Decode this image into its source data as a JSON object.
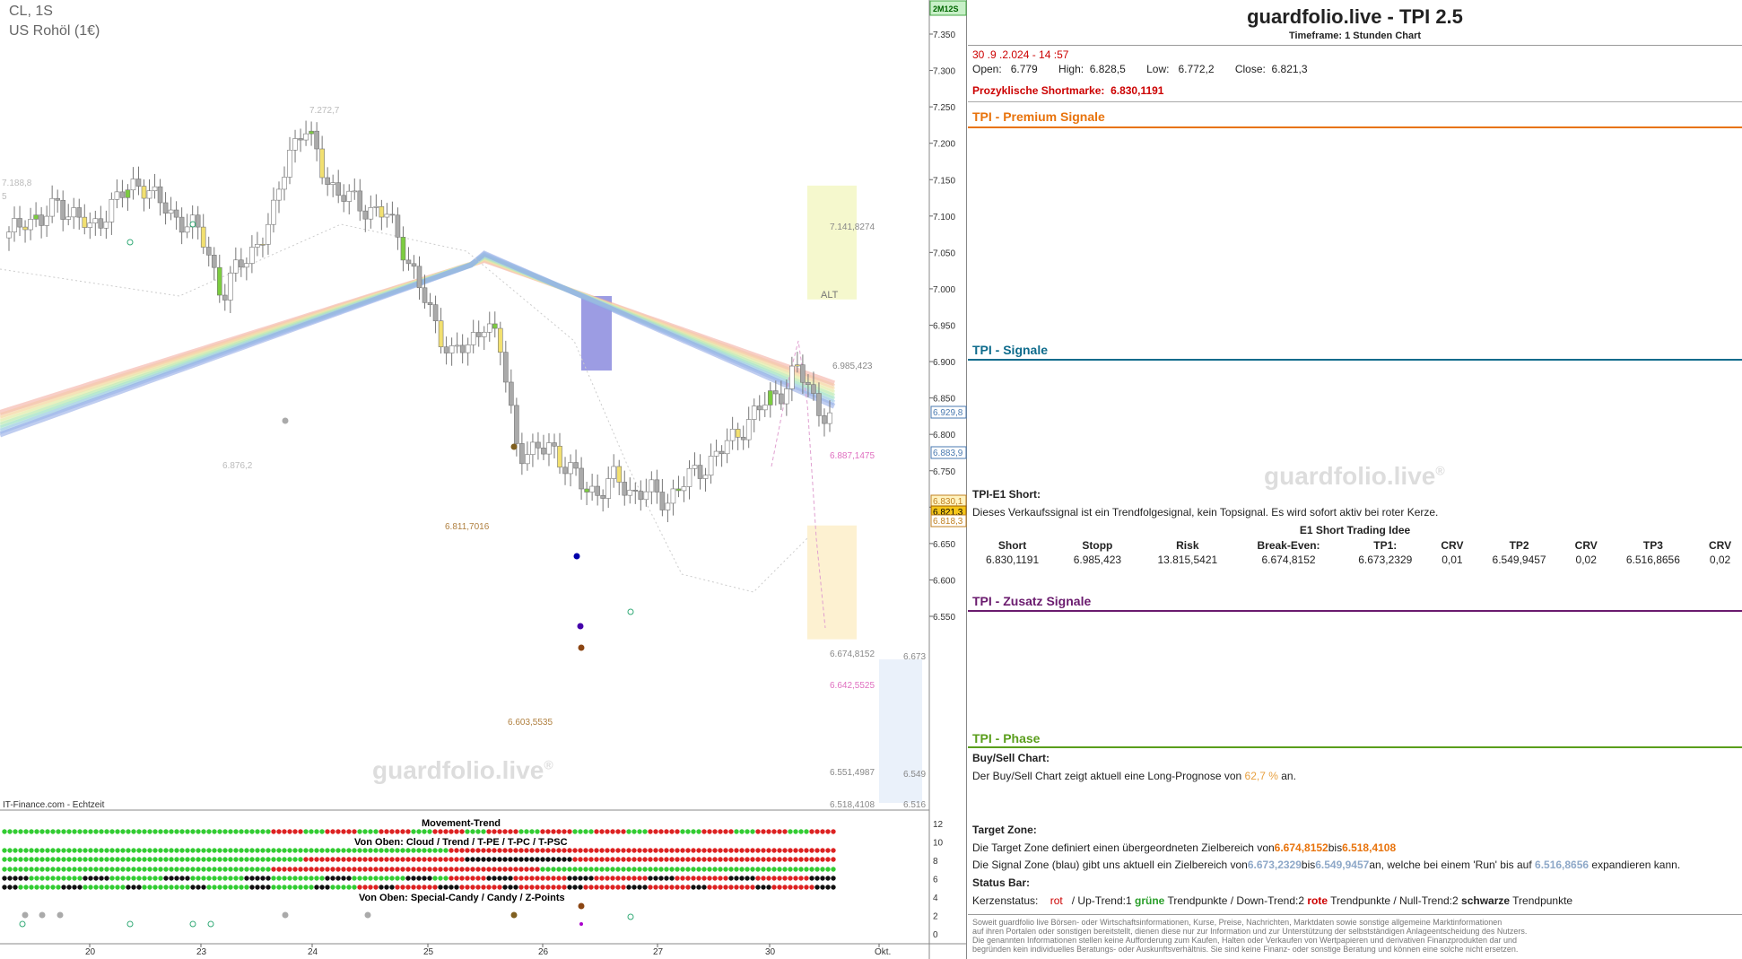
{
  "chart_header": {
    "symbol": "CL, 1S",
    "name": "US Rohöl (1€)",
    "badge": "2M12S"
  },
  "chart_footer": {
    "source": "IT-Finance.com - Echtzeit"
  },
  "watermark": "guardfolio.live",
  "watermark_symbol": "®",
  "indicator_labels": {
    "movement": "Movement-Trend",
    "cloud": "Von Oben: Cloud / Trend / T-PE / T-PC / T-PSC",
    "candy": "Von Oben: Special-Candy / Candy / Z-Points"
  },
  "indicator_axis": [
    "12",
    "10",
    "8",
    "6",
    "4",
    "2",
    "0"
  ],
  "chart_annotations": {
    "alt": "ALT",
    "high_label": "7.272,7",
    "left_label": "7.188,8",
    "left_label2": "5",
    "low_label": "6.876,2",
    "label_6811": "6.811,7016",
    "label_6603": "6.603,5535",
    "zone_top": "7.141,8274",
    "zone_mid": "6.985,423",
    "pink_label": "6.887,1475",
    "tz_top": "6.674,8152",
    "tz_pink": "6.642,5525",
    "tz_low1": "6.551,4987",
    "tz_low2": "6.518,4108",
    "blue_label_1": "6.673",
    "blue_label_2": "6.549",
    "blue_label_3": "6.516"
  },
  "price_boxes": [
    "6.929,8",
    "6.883,9",
    "6.830,1",
    "6.821,3",
    "6.818,3"
  ],
  "chart_data": {
    "type": "candlestick",
    "title": "CL, 1S",
    "x_tick_labels": [
      "20",
      "23",
      "24",
      "25",
      "26",
      "27",
      "30",
      "Okt."
    ],
    "y_tick_labels": [
      "7.350",
      "7.300",
      "7.250",
      "7.200",
      "7.150",
      "7.100",
      "7.050",
      "7.000",
      "6.950",
      "6.900",
      "6.850",
      "6.800",
      "6.750",
      "6.700",
      "6.650",
      "6.600",
      "6.550"
    ],
    "ylim": [
      6.52,
      7.37
    ],
    "grid": false,
    "levels": {
      "short_mark": 6.8301191,
      "stop": 6.985423,
      "target_zone_top": 6.6748152,
      "target_zone_bottom": 6.5184108,
      "signal_zone_top": 6.6732329,
      "signal_zone_bottom": 6.5499457,
      "alt_zone_top": 7.1418274,
      "alt_zone_bottom": 6.985423
    },
    "series": [
      {
        "name": "CL",
        "approx_close_path": [
          7.07,
          7.1,
          7.09,
          7.12,
          7.1,
          7.08,
          7.11,
          7.13,
          7.15,
          7.12,
          7.1,
          7.09,
          7.06,
          6.99,
          7.03,
          7.06,
          7.09,
          7.19,
          7.22,
          7.17,
          7.13,
          7.12,
          7.11,
          7.1,
          7.06,
          7.0,
          6.95,
          6.91,
          6.92,
          6.96,
          6.91,
          6.78,
          6.77,
          6.79,
          6.75,
          6.73,
          6.72,
          6.74,
          6.72,
          6.72,
          6.71,
          6.73,
          6.75,
          6.77,
          6.79,
          6.82,
          6.84,
          6.86,
          6.89,
          6.85,
          6.82
        ]
      }
    ]
  },
  "panel": {
    "title": "guardfolio.live - TPI 2.5",
    "timeframe": "Timeframe: 1 Stunden Chart",
    "datetime": "30 .9 .2.024 - 14 :57",
    "ohlc": "Open:   6.779       High:  6.828,5       Low:   6.772,2       Close:  6.821,3",
    "shortmark_label": "Prozyklische Shortmarke:",
    "shortmark_value": "6.830,1191",
    "sec_premium": "TPI - Premium Signale",
    "sec_signale": "TPI - Signale",
    "sec_zusatz": "TPI - Zusatz Signale",
    "sec_phase": "TPI - Phase",
    "e1_title": "TPI-E1 Short:",
    "e1_text": "Dieses Verkaufssignal ist ein Trendfolgesignal, kein Topsignal. Es wird sofort aktiv bei roter Kerze.",
    "e1_idea": "E1 Short Trading Idee",
    "trade_headers": [
      "Short",
      "Stopp",
      "Risk",
      "Break-Even:",
      "TP1:",
      "CRV",
      "TP2",
      "CRV",
      "TP3",
      "CRV"
    ],
    "trade_values": [
      "6.830,1191",
      "6.985,423",
      "13.815,5421",
      "6.674,8152",
      "6.673,2329",
      "0,01",
      "6.549,9457",
      "0,02",
      "6.516,8656",
      "0,02"
    ],
    "buysell_title": "Buy/Sell Chart:",
    "buysell_text_a": "Der Buy/Sell Chart zeigt aktuell eine Long-Prognose von",
    "buysell_pct": "62,7 %",
    "buysell_text_b": "an.",
    "target_title": "Target Zone:",
    "target_text_a": "Die Target Zone definiert einen übergeordneten Zielbereich von",
    "target_from": "6.674,8152",
    "target_bis": "bis",
    "target_to": "6.518,4108",
    "signal_text_a": "Die Signal Zone (blau) gibt uns aktuell ein Zielbereich von",
    "signal_from": "6.673,2329",
    "signal_bis": "bis",
    "signal_to": "6.549,9457",
    "signal_text_b": "an, welche bei einem 'Run' bis auf",
    "signal_run": "6.516,8656",
    "signal_text_c": "expandieren kann.",
    "status_title": "Status Bar:",
    "status_label": "Kerzenstatus:",
    "status_rot": "rot",
    "status_up": "/ Up-Trend:1",
    "status_gruene": "grüne",
    "status_tp1": "Trendpunkte  / Down-Trend:2",
    "status_rote": "rote",
    "status_tp2": "Trendpunkte / Null-Trend:2",
    "status_schwarze": "schwarze",
    "status_tp3": "Trendpunkte",
    "disclaimer": [
      "Soweit guardfolio live Börsen- oder Wirtschaftsinformationen, Kurse, Preise, Nachrichten, Marktdaten sowie sonstige allgemeine Marktinformationen",
      "auf ihren Portalen oder sonstigen bereitstellt, dienen diese nur zur Information und zur Unterstützung der selbstständigen Anlageentscheidung des Nutzers.",
      "Die genannten Informationen stellen keine Aufforderung zum Kaufen, Halten oder Verkaufen von Wertpapieren und derivativen Finanzprodukten dar und",
      "begründen kein individuelles Beratungs- oder Auskunftsverhältnis. Sie sind keine Finanz- oder sonstige Beratung und können eine solche nicht ersetzen."
    ]
  },
  "colors": {
    "orange": "#e8730c",
    "red": "#cc0000",
    "teal": "#0e6b8c",
    "purple": "#6a1b6e",
    "green": "#5a9e1c",
    "blue_val": "#8ea8c8"
  }
}
